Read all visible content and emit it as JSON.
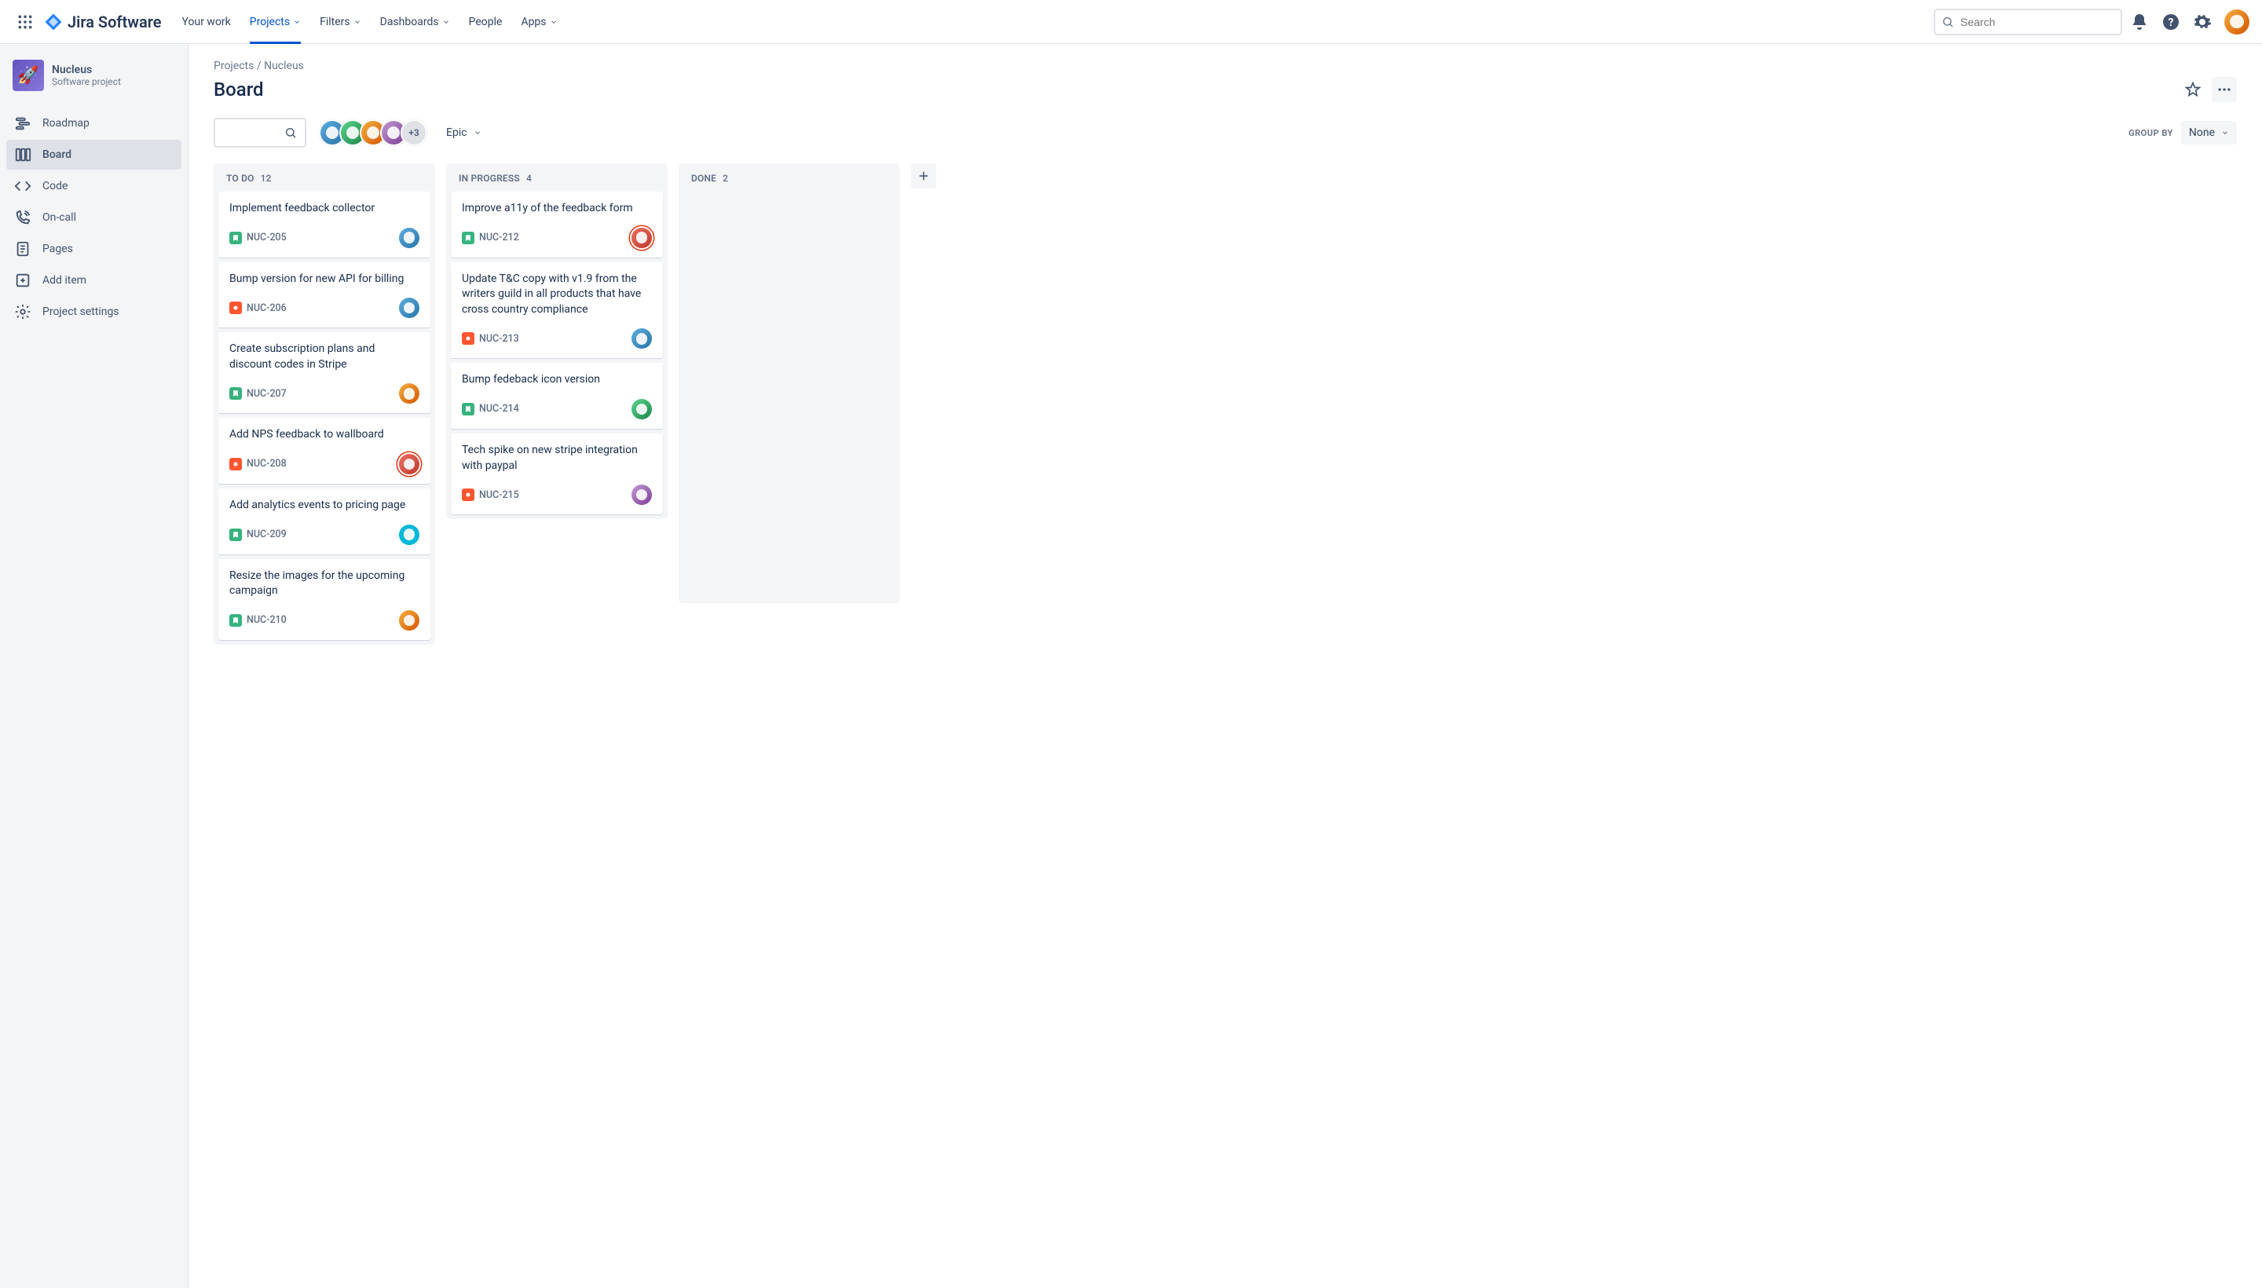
{
  "brand": "Jira Software",
  "nav": {
    "yourWork": "Your work",
    "projects": "Projects",
    "filters": "Filters",
    "dashboards": "Dashboards",
    "people": "People",
    "apps": "Apps"
  },
  "search": {
    "placeholder": "Search"
  },
  "project": {
    "name": "Nucleus",
    "subtitle": "Software project"
  },
  "sidebar": {
    "roadmap": "Roadmap",
    "board": "Board",
    "code": "Code",
    "oncall": "On-call",
    "pages": "Pages",
    "addItem": "Add item",
    "projectSettings": "Project settings"
  },
  "breadcrumb": {
    "projects": "Projects",
    "sep": " / ",
    "current": "Nucleus"
  },
  "page": {
    "title": "Board"
  },
  "controls": {
    "epic": "Epic",
    "avatarOverflow": "+3",
    "groupByLabel": "GROUP BY",
    "groupByValue": "None"
  },
  "columns": [
    {
      "id": "todo",
      "title": "TO DO",
      "count": "12",
      "cards": [
        {
          "title": "Implement feedback collector",
          "key": "NUC-205",
          "type": "story",
          "av": "av-c"
        },
        {
          "title": "Bump version for new API for billing",
          "key": "NUC-206",
          "type": "bug",
          "av": "av-c"
        },
        {
          "title": "Create subscription plans and discount codes in Stripe",
          "key": "NUC-207",
          "type": "story",
          "av": "av-b"
        },
        {
          "title": "Add NPS feedback to wallboard",
          "key": "NUC-208",
          "type": "bug",
          "av": "av-e",
          "ring": "av-ring-pink"
        },
        {
          "title": "Add analytics events to pricing page",
          "key": "NUC-209",
          "type": "story",
          "av": "av-f"
        },
        {
          "title": "Resize the images for the upcoming campaign",
          "key": "NUC-210",
          "type": "story",
          "av": "av-b"
        }
      ]
    },
    {
      "id": "inprogress",
      "title": "IN PROGRESS",
      "count": "4",
      "cards": [
        {
          "title": "Improve a11y of the feedback form",
          "key": "NUC-212",
          "type": "story",
          "av": "av-e",
          "ring": "av-ring-pink"
        },
        {
          "title": "Update T&C copy with v1.9 from the writers guild in all products that have cross country compliance",
          "key": "NUC-213",
          "type": "bug",
          "av": "av-c"
        },
        {
          "title": "Bump fedeback icon version",
          "key": "NUC-214",
          "type": "story",
          "av": "av-d"
        },
        {
          "title": "Tech spike on new stripe integration with paypal",
          "key": "NUC-215",
          "type": "bug",
          "av": "av-a"
        }
      ]
    },
    {
      "id": "done",
      "title": "DONE",
      "count": "2",
      "cards": []
    }
  ]
}
